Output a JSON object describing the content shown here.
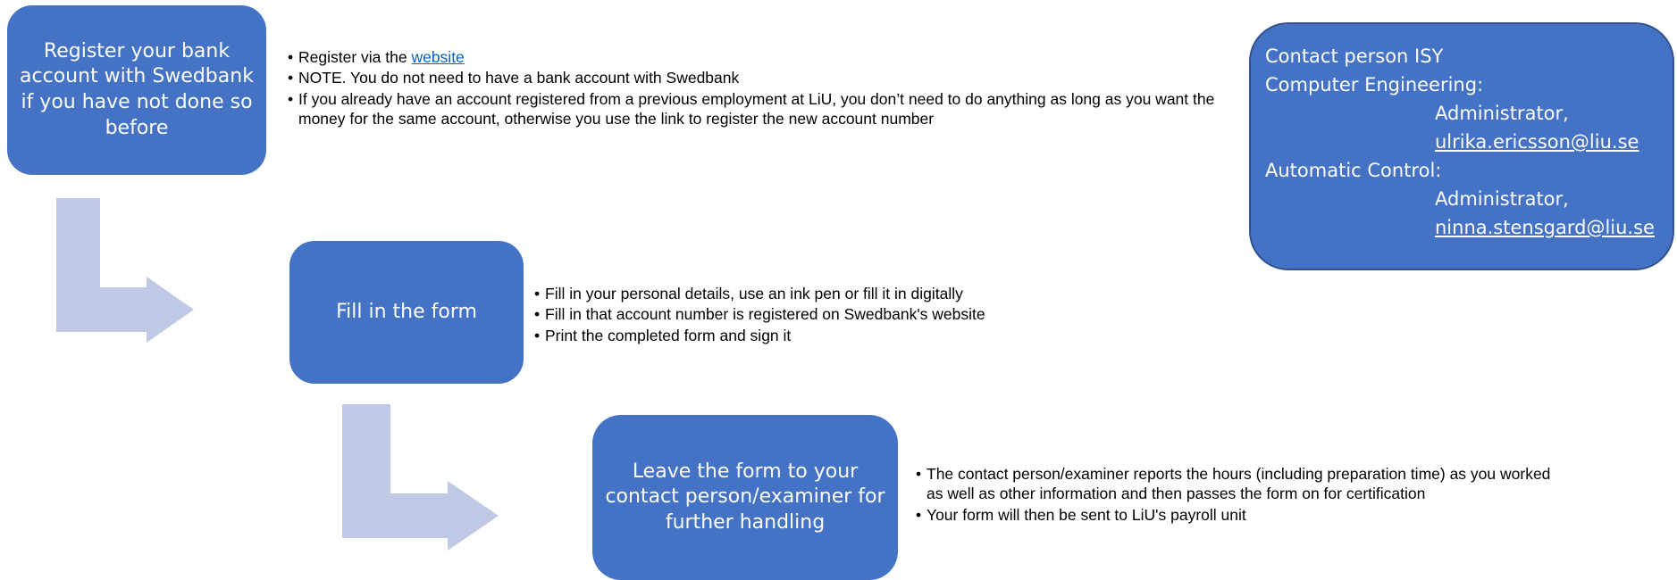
{
  "steps": [
    {
      "label": "Register your bank account with Swedbank if you have not done so before"
    },
    {
      "label": "Fill in the form"
    },
    {
      "label": "Leave the form to your contact person/examiner for further handling"
    }
  ],
  "step1_bullets": {
    "b1_prefix": "Register via the ",
    "b1_link": "website",
    "b2": "NOTE. You do not need to have a bank account with Swedbank",
    "b3": "If you already have an account registered from a previous employment at LiU, you don’t need to do anything as long as you want the money for the same account, otherwise you use the link to register the new account number"
  },
  "step2_bullets": [
    "Fill in your personal details, use an ink pen or fill it in digitally",
    "Fill in that account number is registered on Swedbank's website",
    "Print the completed form and sign it"
  ],
  "step3_bullets": [
    "The contact person/examiner reports the hours (including preparation time) as you worked as well as other information and then passes the form on for certification",
    "Your form will then be sent to LiU's payroll unit"
  ],
  "contact": {
    "title": "Contact person ISY",
    "dept1": "Computer Engineering:",
    "dept1_role": "Administrator,",
    "dept1_email": "ulrika.ericsson@liu.se",
    "dept2": "Automatic Control:",
    "dept2_role": "Administrator,",
    "dept2_email": "ninna.stensgard@liu.se"
  },
  "colors": {
    "box_fill": "#4472C4",
    "arrow_fill": "#BFC9E5",
    "link": "#0563C1"
  }
}
